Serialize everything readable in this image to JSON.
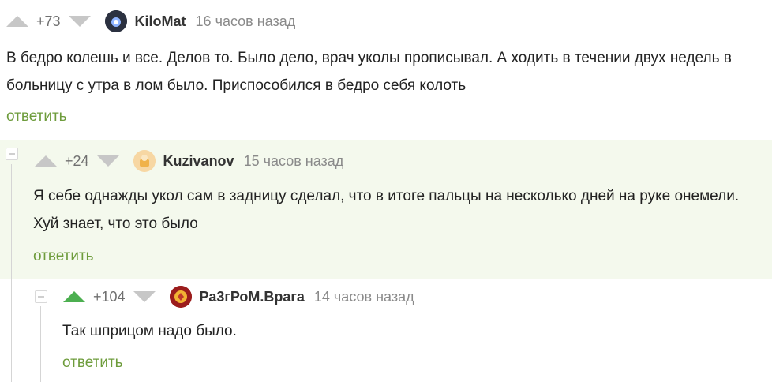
{
  "comments": [
    {
      "rating": "+73",
      "author": "KiloMat",
      "time": "16 часов назад",
      "text": "В бедро колешь и все. Делов то. Было дело, врач уколы прописывал. А ходить в течении двух недель в больницу с утра в лом было. Приспособился в бедро себя колоть",
      "reply": "ответить"
    },
    {
      "rating": "+24",
      "author": "Kuzivanov",
      "time": "15 часов назад",
      "text": "Я себе однажды укол сам в задницу сделал, что в итоге пальцы на несколько дней на руке онемели. Хуй знает, что это было",
      "reply": "ответить"
    },
    {
      "rating": "+104",
      "author": "Ра3гРоМ.Врага",
      "time": "14 часов назад",
      "text": "Так шприцом надо было.",
      "reply": "ответить"
    }
  ],
  "colors": {
    "accent_green": "#6e9c3c",
    "upvote_active": "#4caf50",
    "nested_bg": "#f4f9ed"
  }
}
